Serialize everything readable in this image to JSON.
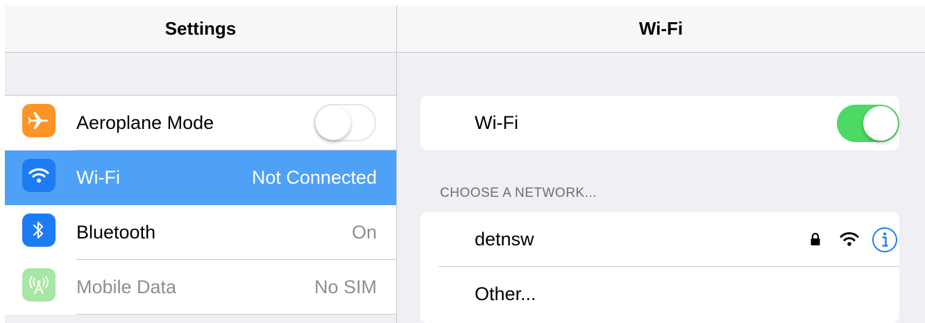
{
  "left_panel": {
    "title": "Settings",
    "items": [
      {
        "label": "Aeroplane Mode",
        "icon": "airplane-icon",
        "icon_color": "#fd9426",
        "toggle": "off"
      },
      {
        "label": "Wi-Fi",
        "value": "Not Connected",
        "icon": "wifi-icon",
        "icon_color": "#1c7cf4",
        "selected": true
      },
      {
        "label": "Bluetooth",
        "value": "On",
        "icon": "bluetooth-icon",
        "icon_color": "#1c7cf4"
      },
      {
        "label": "Mobile Data",
        "value": "No SIM",
        "icon": "antenna-icon",
        "icon_color": "#a8e6a6",
        "disabled": true
      }
    ]
  },
  "right_panel": {
    "title": "Wi-Fi",
    "wifi_toggle": {
      "label": "Wi-Fi",
      "state": "on"
    },
    "section_title": "CHOOSE A NETWORK...",
    "networks": [
      {
        "name": "detnsw",
        "secured": true,
        "icons": [
          "lock-icon",
          "wifi-signal-icon",
          "info-icon"
        ]
      },
      {
        "name": "Other..."
      }
    ]
  },
  "colors": {
    "accent": "#4fa1f7",
    "toggle_on": "#4cd964",
    "info_blue": "#1c7cf4"
  }
}
